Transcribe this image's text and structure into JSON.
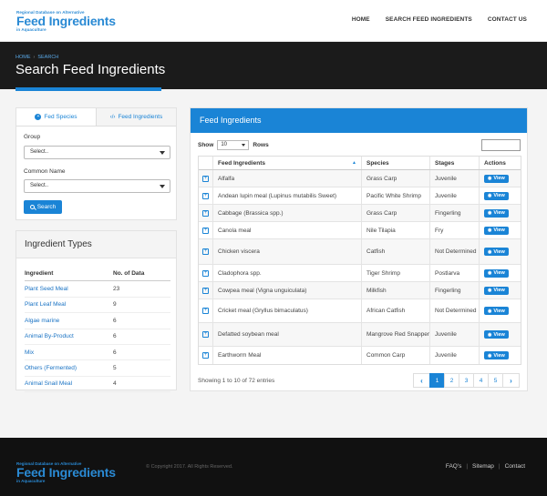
{
  "site": {
    "logo_small_top": "Regional Database on Alternative",
    "logo_big": "Feed Ingredients",
    "logo_small_bottom": "in Aquaculture"
  },
  "nav": {
    "home": "HOME",
    "search": "SEARCH FEED INGREDIENTS",
    "contact": "CONTACT US"
  },
  "breadcrumb": {
    "home": "HOME",
    "current": "SEARCH"
  },
  "page_title": "Search Feed Ingredients",
  "search_panel": {
    "tab_species": "Fed Species",
    "tab_ingredients": "Feed Ingredients",
    "group_label": "Group",
    "group_value": "Select..",
    "common_label": "Common Name",
    "common_value": "Select..",
    "search_button": "Search"
  },
  "ingredient_types": {
    "title": "Ingredient Types",
    "col_name": "Ingredient",
    "col_count": "No. of Data",
    "rows": [
      {
        "name": "Plant Seed Meal",
        "count": "23"
      },
      {
        "name": "Plant Leaf Meal",
        "count": "9"
      },
      {
        "name": "Algae marine",
        "count": "6"
      },
      {
        "name": "Animal By-Product",
        "count": "6"
      },
      {
        "name": "Mix",
        "count": "6"
      },
      {
        "name": "Others (Fermented)",
        "count": "5"
      },
      {
        "name": "Animal Snail Meal",
        "count": "4"
      }
    ]
  },
  "feed_table": {
    "title": "Feed Ingredients",
    "show_label": "Show",
    "show_value": "10",
    "rows_label": "Rows",
    "columns": {
      "ingredient": "Feed Ingredients",
      "species": "Species",
      "stages": "Stages",
      "actions": "Actions"
    },
    "view_label": "View",
    "rows": [
      {
        "ingredient": "Alfalfa",
        "species": "Grass Carp",
        "stage": "Juvenile"
      },
      {
        "ingredient": "Andean lupin meal (Lupinus mutabilis Sweet)",
        "species": "Pacific White Shrimp",
        "stage": "Juvenile"
      },
      {
        "ingredient": "Cabbage (Brassica spp.)",
        "species": "Grass Carp",
        "stage": "Fingerling"
      },
      {
        "ingredient": "Canola meal",
        "species": "Nile Tilapia",
        "stage": "Fry"
      },
      {
        "ingredient": "Chicken viscera",
        "species": "Catfish",
        "stage": "Not Determined"
      },
      {
        "ingredient": "Cladophora spp.",
        "species": "Tiger Shrimp",
        "stage": "Postlarva"
      },
      {
        "ingredient": "Cowpea meal (Vigna unguiculata)",
        "species": "Milkfish",
        "stage": "Fingerling"
      },
      {
        "ingredient": "Cricket meal (Gryllus bimaculatus)",
        "species": "African Catfish",
        "stage": "Not Determined"
      },
      {
        "ingredient": "Defatted soybean meal",
        "species": "Mangrove Red Snapper",
        "stage": "Juvenile"
      },
      {
        "ingredient": "Earthworm Meal",
        "species": "Common Carp",
        "stage": "Juvenile"
      }
    ],
    "entries_text": "Showing 1 to 10 of 72 entries",
    "pages": [
      "1",
      "2",
      "3",
      "4",
      "5"
    ],
    "prev": "‹",
    "next": "›"
  },
  "footer": {
    "copyright": "© Copyright 2017. All Rights Reserved.",
    "faq": "FAQ's",
    "sitemap": "Sitemap",
    "contact": "Contact"
  },
  "colors": {
    "accent": "#1a84d6",
    "dark": "#1b1b1b"
  }
}
